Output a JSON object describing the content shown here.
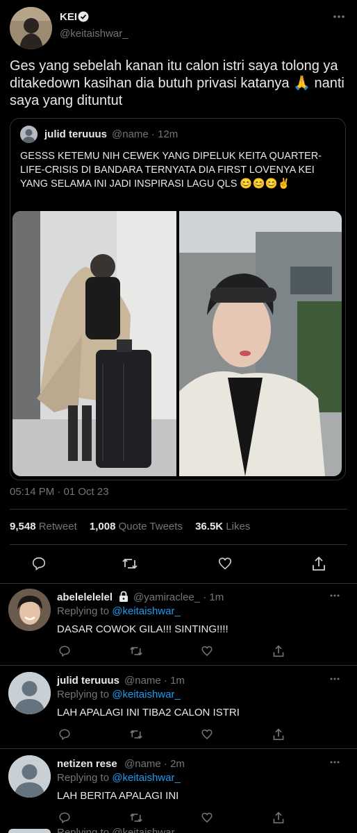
{
  "main_tweet": {
    "name": "KEI",
    "handle": "@keitaishwar_",
    "text": "Ges yang sebelah kanan itu calon istri saya tolong ya ditakedown kasihan dia butuh privasi katanya 🙏 nanti saya yang dituntut",
    "more_icon": "more-icon",
    "quote": {
      "name": "julid teruuus",
      "handle": "@name · 12m",
      "text": "GESSS KETEMU NIH CEWEK YANG DIPELUK KEITA QUARTER-LIFE-CRISIS DI BANDARA TERNYATA DIA FIRST LOVENYA KEI YANG SELAMA INI JADI INSPIRASI LAGU QLS 😊😊😊✌️"
    },
    "timestamp": "05:14 PM · 01 Oct 23",
    "stats": {
      "retweets_count": "9,548",
      "retweets_label": "Retweet",
      "quotes_count": "1,008",
      "quotes_label": "Quote Tweets",
      "likes_count": "36.5K",
      "likes_label": "Likes"
    }
  },
  "replies": [
    {
      "name": "abelelelelel",
      "handle": "@yamiraclee_ · 1m",
      "replying_prefix": "Replying to",
      "replying_to": "@keitaishwar_",
      "text": "DASAR COWOK GILA!!! SINTING!!!!"
    },
    {
      "name": "julid teruuus",
      "handle": "@name · 1m",
      "replying_prefix": "Replying to",
      "replying_to": "@keitaishwar_",
      "text": "LAH APALAGI INI TIBA2 CALON ISTRI"
    },
    {
      "name": "netizen rese",
      "handle": "@name · 2m",
      "replying_prefix": "Replying to",
      "replying_to": "@keitaishwar_",
      "text": "LAH BERITA APALAGI INI"
    }
  ],
  "partial_reply": {
    "replying_text": "Replying to @keitaishwar_"
  },
  "colors": {
    "background": "#000000",
    "text": "#e7e9ea",
    "muted": "#71767b",
    "link": "#1d9bf0",
    "divider": "#2f3336"
  }
}
